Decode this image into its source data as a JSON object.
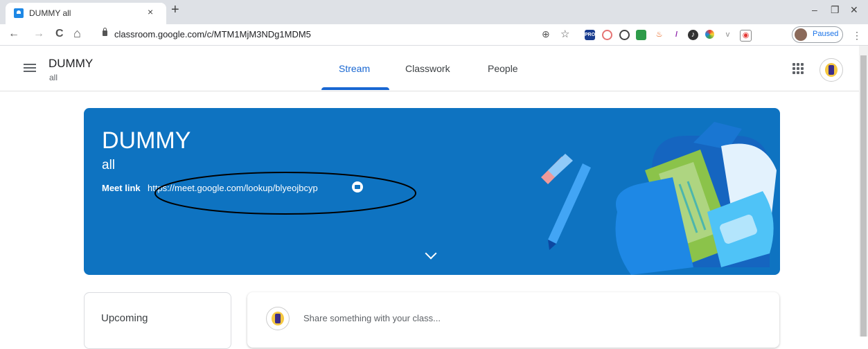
{
  "browser": {
    "tab_title": "DUMMY all",
    "tab_close": "×",
    "new_tab": "+",
    "url": "classroom.google.com/c/MTM1MjM3NDg1MDM5",
    "profile_status": "Paused",
    "window_controls": {
      "minimize": "–",
      "restore": "❐",
      "close": "✕"
    },
    "nav": {
      "back": "←",
      "forward": "→",
      "reload": "C",
      "home": "⌂"
    },
    "omnibox_icons": {
      "zoom": "⊕",
      "star": "☆"
    },
    "extensions": [
      "pro-extension-icon",
      "block-extension-icon",
      "no-entry-icon",
      "shield-extension-icon",
      "java-icon",
      "pen-icon",
      "music-icon",
      "color-wheel-icon",
      "shield-v-icon",
      "screenshot-icon"
    ],
    "ext_pro_label": "PRO",
    "menu": "⋮"
  },
  "header": {
    "class_name": "DUMMY",
    "section": "all",
    "tabs": [
      {
        "label": "Stream",
        "active": true
      },
      {
        "label": "Classwork",
        "active": false
      },
      {
        "label": "People",
        "active": false
      }
    ]
  },
  "banner": {
    "title": "DUMMY",
    "section": "all",
    "meet_label": "Meet link",
    "meet_url": "https://meet.google.com/lookup/blyeojbcyp",
    "color": "#0e73c1"
  },
  "upcoming": {
    "title": "Upcoming"
  },
  "share": {
    "placeholder": "Share something with your class..."
  },
  "colors": {
    "accent": "#1967d2",
    "banner": "#0e73c1"
  }
}
